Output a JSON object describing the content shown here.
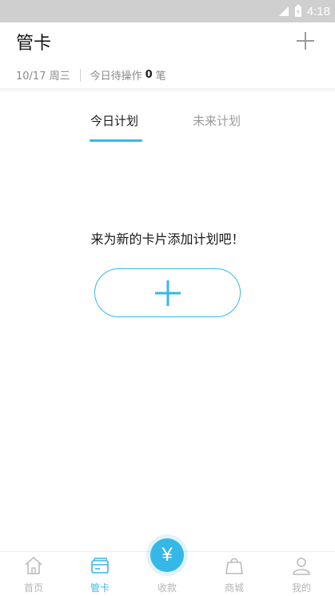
{
  "status_bar": {
    "time": "4:18"
  },
  "header": {
    "title": "管卡",
    "date": "10/17 周三",
    "pending_label": "今日待操作",
    "pending_count": "0",
    "pending_unit": "笔"
  },
  "tabs": [
    {
      "label": "今日计划",
      "active": true
    },
    {
      "label": "未来计划",
      "active": false
    }
  ],
  "empty_state": {
    "message": "来为新的卡片添加计划吧！"
  },
  "bottom_nav": {
    "items": [
      {
        "label": "首页",
        "icon": "home-icon"
      },
      {
        "label": "管卡",
        "icon": "card-icon",
        "active": true
      },
      {
        "label": "收款",
        "icon": "yen-icon"
      },
      {
        "label": "商城",
        "icon": "shopping-bag-icon"
      },
      {
        "label": "我的",
        "icon": "user-icon"
      }
    ],
    "fab_symbol": "¥"
  },
  "colors": {
    "accent": "#35b8e8",
    "muted_text": "#8a8a8a",
    "status_bar": "#cfcfcf"
  }
}
